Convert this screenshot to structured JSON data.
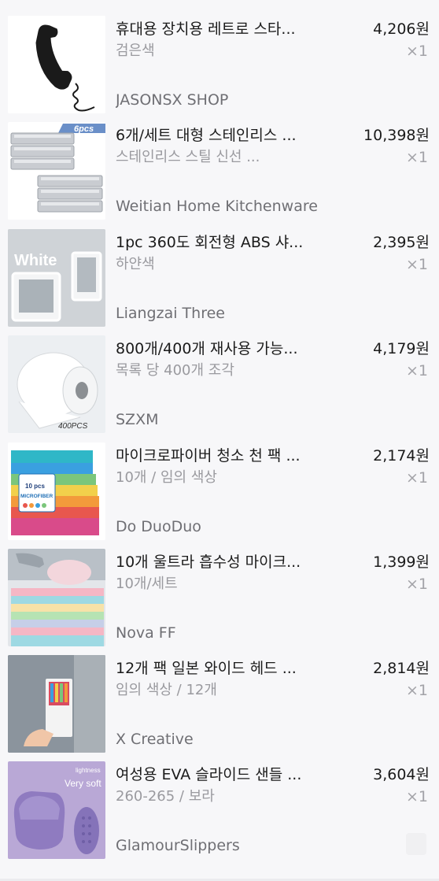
{
  "orders": [
    {
      "title": "휴대용 장치용 레트로 스타...",
      "variant": "검은색",
      "shop": "JASONSX SHOP",
      "price": "4,206원",
      "qty": "×1",
      "icon": "telephone-handset-image"
    },
    {
      "title": "6개/세트 대형 스테인리스 ...",
      "variant": "스테인리스 스틸 신선 ...",
      "shop": "Weitian Home Kitchenware",
      "price": "10,398원",
      "qty": "×1",
      "icon": "steel-trays-image",
      "badge": "6pcs"
    },
    {
      "title": "1pc 360도 회전형 ABS 샤...",
      "variant": "하얀색",
      "shop": "Liangzai Three",
      "price": "2,395원",
      "qty": "×1",
      "icon": "shower-phone-case-image",
      "badge": "White"
    },
    {
      "title": "800개/400개 재사용 가능...",
      "variant": "목록 당 400개 조각",
      "shop": "SZXM",
      "price": "4,179원",
      "qty": "×1",
      "icon": "towel-roll-image",
      "badge": "400PCS"
    },
    {
      "title": "마이크로파이버 청소 천 팩 ...",
      "variant": "10개 / 임의 색상",
      "shop": "Do DuoDuo",
      "price": "2,174원",
      "qty": "×1",
      "icon": "microfiber-cloths-image",
      "badge": "10 pcs",
      "badge2": "MICROFIBER"
    },
    {
      "title": "10개 울트라 흡수성 마이크...",
      "variant": "10개/세트",
      "shop": "Nova FF",
      "price": "1,399원",
      "qty": "×1",
      "icon": "kitchen-sponge-cloth-image"
    },
    {
      "title": "12개 팩 일본 와이드 헤드 ...",
      "variant": "임의 색상 / 12개",
      "shop": "X Creative",
      "price": "2,814원",
      "qty": "×1",
      "icon": "toothbrush-pack-image"
    },
    {
      "title": "여성용 EVA 슬라이드 샌들 ...",
      "variant": "260-265 / 보라",
      "shop": "GlamourSlippers",
      "price": "3,604원",
      "qty": "×1",
      "icon": "slide-sandal-image",
      "badge": "Very soft",
      "badge2": "lightness"
    }
  ],
  "colors": {
    "background": "#f7f7f9",
    "text": "#1b1b1b",
    "muted": "#9a9a9f"
  }
}
